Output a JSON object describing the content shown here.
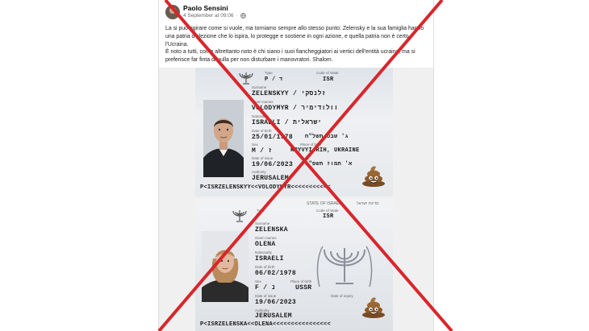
{
  "post": {
    "author": "Paolo Sensini",
    "date": "4 September at 09:06",
    "text_p1": "La si può rigirare come si vuole, ma torniamo sempre allo stesso punto: Zelensky e la sua famiglia hanno una patria d'elezione che lo ispira, lo protegge e sostiene in ogni azione, e quella patria non è certo l'Ucraina.",
    "text_p2": "È noto a tutti, come altrettanto noto è chi siano i suoi fiancheggiatori ai vertici dell'entità ucraina, ma si preferisce far finta di nulla per non disturbare i manovratori. Shalom."
  },
  "passport1": {
    "type_label": "Type",
    "type": "P / ד",
    "state_label": "Code of State",
    "state": "ISR",
    "surname_label": "Surname",
    "surname": "ZELENSKYY / זלנסקי",
    "given_label": "Given names",
    "given": "VOLODYMYR / וולודימיר",
    "nationality_label": "Nationality",
    "nationality": "ISRAELI / ישראלית",
    "dob_label": "Date of birth",
    "dob": "25/01/1978",
    "dob_heb": "ג' שבט תשל\"ח",
    "sex_label": "Sex",
    "sex": "M / ז",
    "pob_label": "Place of birth",
    "pob": "KRYVYI RIH, UKRAINE",
    "issue_label": "Date of issue",
    "issue": "19/06/2023",
    "issue_heb": "א' תמוז תשפ\"ג",
    "authority_label": "Authority",
    "authority": "JERUSALEM",
    "mrz": "P<ISRZELENSKYY<<VOLODYMYR<<<<<<<<<<<"
  },
  "passport2": {
    "state_header": "STATE OF ISRAEL",
    "state_header_heb": "מדינת ישראל",
    "type_label": "Type",
    "type": "P",
    "state_label": "Code of State",
    "state": "ISR",
    "surname_label": "Surname",
    "surname": "ZELENSKA",
    "given_label": "Given names",
    "given": "OLENA",
    "nationality_label": "Nationality",
    "nationality": "ISRAELI",
    "dob_label": "Date of birth",
    "dob": "06/02/1978",
    "sex_label": "Sex",
    "sex": "F / נ",
    "pob_label": "Place of birth",
    "pob": "USSR",
    "issue_label": "Date of issue",
    "issue": "19/06/2023",
    "authority_label": "Authority",
    "authority": "JERUSALEM",
    "expiry_label": "Date of expiry",
    "mrz": "P<ISRZELENSKA<<OLENA<<<<<<<<<<<<<<<<"
  },
  "colors": {
    "cross": "#d8262b",
    "author": "#050505",
    "meta": "#65676b"
  }
}
